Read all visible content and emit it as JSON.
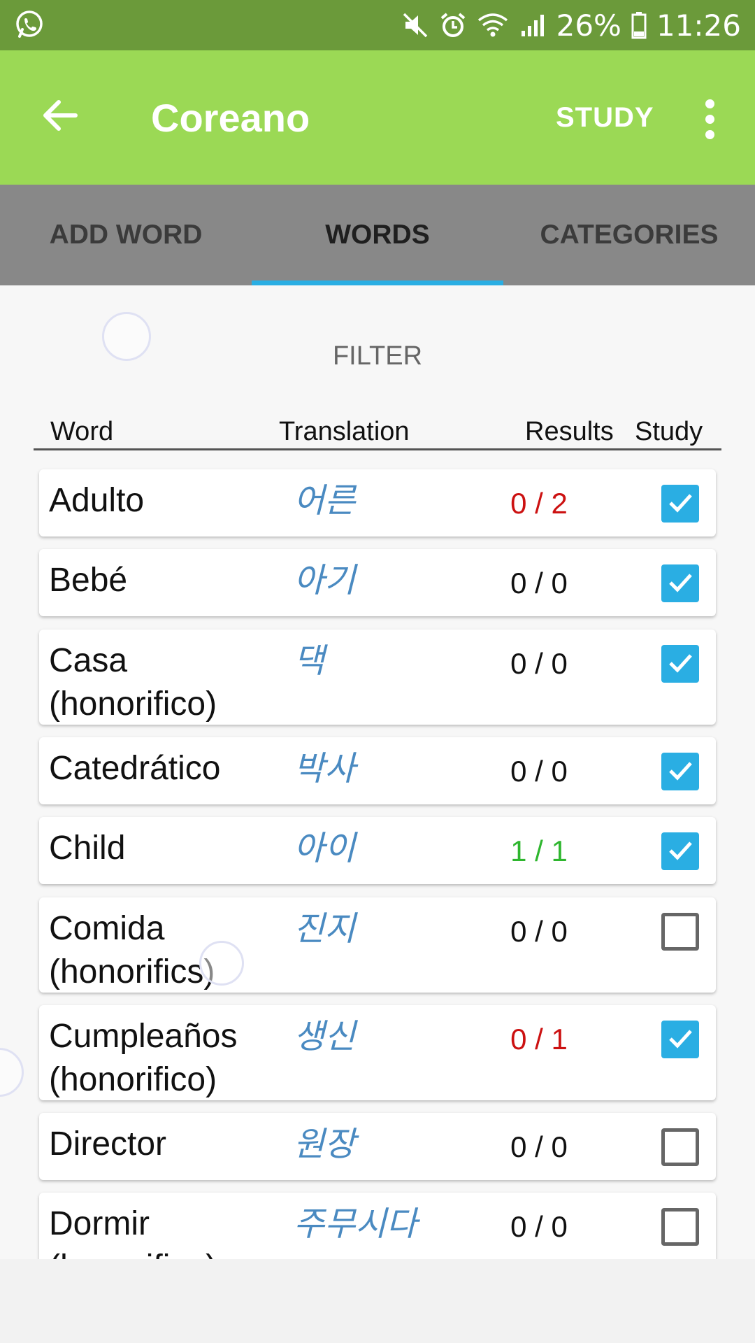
{
  "status_bar": {
    "left_icon": "whatsapp-icon",
    "icons": [
      "mute-icon",
      "alarm-icon",
      "wifi-icon",
      "signal-icon"
    ],
    "battery_percent": "26%",
    "time": "11:26"
  },
  "app_bar": {
    "back_icon": "arrow-back-icon",
    "title": "Coreano",
    "study_label": "STUDY",
    "more_icon": "more-vert-icon"
  },
  "tabs": [
    {
      "label": "ADD WORD",
      "active": false
    },
    {
      "label": "WORDS",
      "active": true
    },
    {
      "label": "CATEGORIES",
      "active": false
    }
  ],
  "filter_label": "FILTER",
  "table_headers": {
    "word": "Word",
    "translation": "Translation",
    "results": "Results",
    "study": "Study"
  },
  "words": [
    {
      "word": "Adulto",
      "translation": "어른",
      "result": "0 / 2",
      "result_color": "red",
      "study": true
    },
    {
      "word": "Bebé",
      "translation": "아기",
      "result": "0 / 0",
      "result_color": "black",
      "study": true
    },
    {
      "word": "Casa (honorifico)",
      "translation": "댁",
      "result": "0 / 0",
      "result_color": "black",
      "study": true
    },
    {
      "word": "Catedrático",
      "translation": "박사",
      "result": "0 / 0",
      "result_color": "black",
      "study": true
    },
    {
      "word": "Child",
      "translation": "아이",
      "result": "1 / 1",
      "result_color": "green",
      "study": true
    },
    {
      "word": "Comida (honorifics)",
      "translation": "진지",
      "result": "0 / 0",
      "result_color": "black",
      "study": false
    },
    {
      "word": "Cumpleaños (honorifico)",
      "translation": "생신",
      "result": "0 / 1",
      "result_color": "red",
      "study": true
    },
    {
      "word": "Director",
      "translation": "원장",
      "result": "0 / 0",
      "result_color": "black",
      "study": false
    },
    {
      "word": "Dormir (honorifico)",
      "translation": "주무시다",
      "result": "0 / 0",
      "result_color": "black",
      "study": false
    }
  ],
  "colors": {
    "status_bar": "#6b9a3a",
    "app_bar": "#9bd955",
    "tabs_bg": "#888888",
    "tab_indicator": "#2aaee3",
    "translation_text": "#4a8ac1",
    "checkbox_on": "#2aaee3",
    "result_red": "#cc1111",
    "result_green": "#2eb62e"
  }
}
